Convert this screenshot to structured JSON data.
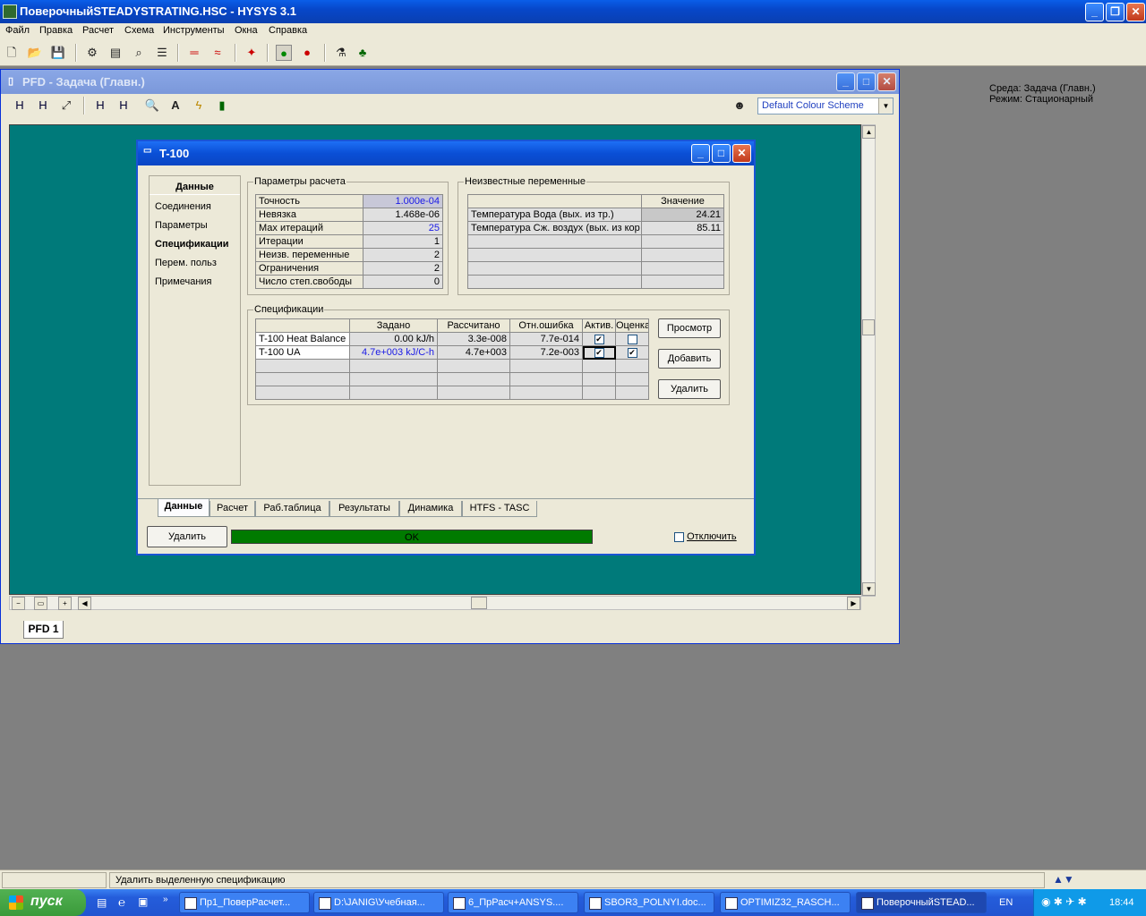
{
  "app": {
    "title": "ПоверочныйSTEADYSTRATING.HSC - HYSYS 3.1",
    "menu": [
      "Файл",
      "Правка",
      "Расчет",
      "Схема",
      "Инструменты",
      "Окна",
      "Справка"
    ],
    "env_line1": "Среда: Задача (Главн.)",
    "env_line2": "Режим: Стационарный"
  },
  "pfd": {
    "title": "PFD - Задача (Главн.)",
    "color_scheme": "Default Colour Scheme",
    "tab": "PFD 1"
  },
  "dialog": {
    "title": "T-100",
    "nav": [
      "Данные",
      "Соединения",
      "Параметры",
      "Спецификации",
      "Перем. польз",
      "Примечания"
    ],
    "calc_params": {
      "label": "Параметры расчета",
      "rows": [
        {
          "name": "Точность",
          "value": "1.000e-04"
        },
        {
          "name": "Невязка",
          "value": "1.468e-06"
        },
        {
          "name": "Мах итераций",
          "value": "25"
        },
        {
          "name": "Итерации",
          "value": "1"
        },
        {
          "name": "Неизв. переменные",
          "value": "2"
        },
        {
          "name": "Ограничения",
          "value": "2"
        },
        {
          "name": "Число степ.свободы",
          "value": "0"
        }
      ]
    },
    "unknowns": {
      "label": "Неизвестные переменные",
      "header": "Значение",
      "rows": [
        {
          "name": "Температура Вода (вых. из тр.)",
          "value": "24.21"
        },
        {
          "name": "Температура Сж. воздух (вых. из кор",
          "value": "85.11"
        }
      ]
    },
    "specs": {
      "label": "Спецификации",
      "headers": [
        "Задано",
        "Рассчитано",
        "Отн.ошибка",
        "Актив.",
        "Оценка"
      ],
      "rows": [
        {
          "name": "T-100 Heat Balance",
          "set": "0.00 kJ/h",
          "calc": "3.3e-008",
          "err": "7.7e-014",
          "active": "✔",
          "estimate": ""
        },
        {
          "name": "T-100 UA",
          "set": "4.7e+003 kJ/C-h",
          "calc": "4.7e+003",
          "err": "7.2e-003",
          "active": "✔",
          "estimate": "✔"
        }
      ],
      "buttons": {
        "view": "Просмотр",
        "add": "Добавить",
        "delete": "Удалить"
      }
    },
    "tabs": [
      "Данные",
      "Расчет",
      "Раб.таблица",
      "Результаты",
      "Динамика",
      "HTFS - TASC"
    ],
    "delete_button": "Удалить",
    "status": "OK",
    "ignore_label": "Отключить"
  },
  "statusbar": {
    "text": "Удалить выделенную спецификацию"
  },
  "taskbar": {
    "start": "пуск",
    "items": [
      "Пр1_ПоверРасчет...",
      "D:\\JANIG\\Учебная...",
      "6_ПрРасч+ANSYS....",
      "SBOR3_POLNYI.doc...",
      "OPTIMIZ32_RASCH...",
      "ПоверочныйSTEAD..."
    ],
    "lang": "EN",
    "clock": "18:44"
  }
}
